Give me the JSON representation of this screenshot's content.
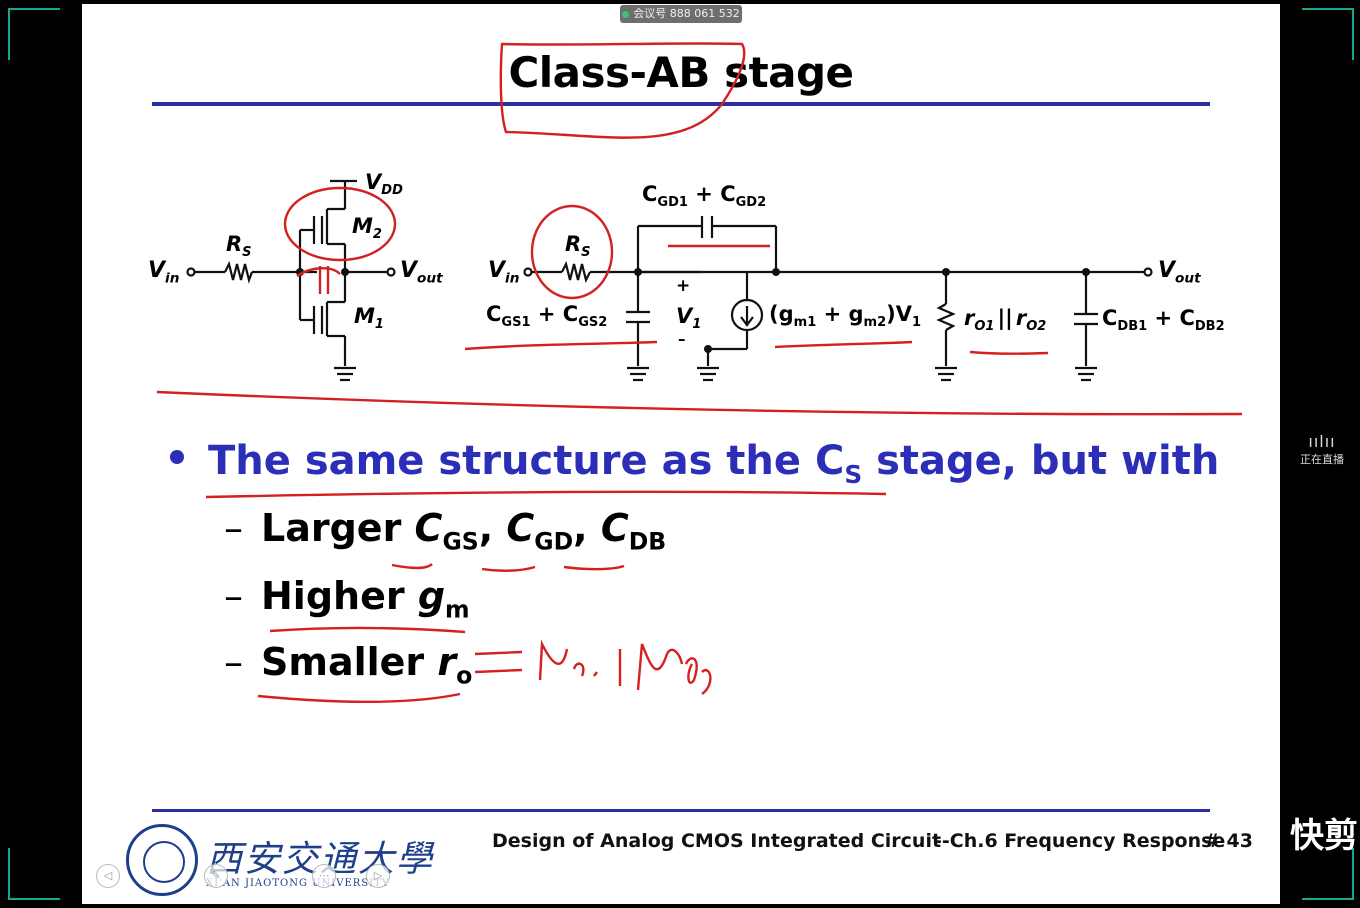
{
  "meeting_badge": "会议号 888 061 532",
  "slide": {
    "title": "Class-AB stage",
    "bullet": "The same structure as the C",
    "bullet_sub": "S",
    "bullet_tail": " stage, but with",
    "items": [
      {
        "text": "Larger ",
        "parts": [
          "C",
          "GS",
          ", ",
          "C",
          "GD",
          ", ",
          "C",
          "DB"
        ]
      },
      {
        "text": "Higher ",
        "parts": [
          "g",
          "m"
        ]
      },
      {
        "text": "Smaller ",
        "parts": [
          "r",
          "o"
        ]
      }
    ],
    "dash": "–",
    "footer_left": "Design of Analog CMOS Integrated Circuit",
    "footer_right": "--Ch.6 Frequency Response",
    "page": "# 43",
    "handwriting": "= r₀₁ || r₀₂",
    "university_cn": "西安交通大學",
    "university_en": "XI'AN JIAOTONG UNIVERSITY"
  },
  "circuit": {
    "vdd": "V",
    "vdd_sub": "DD",
    "m2": "M",
    "m2_sub": "2",
    "m1": "M",
    "m1_sub": "1",
    "rs": "R",
    "rs_sub": "S",
    "vin": "V",
    "vin_sub": "in",
    "vout": "V",
    "vout_sub": "out",
    "cgd": "C",
    "cgd1_sub": "GD1",
    "plus": "+",
    "cgd2_sub": "GD2",
    "cgs": "C",
    "cgs1_sub": "GS1",
    "cgs2_sub": "GS2",
    "v1": "V",
    "v1_sub": "1",
    "gm_text": "(g",
    "gm1_sub": "m1",
    "gm2": " + g",
    "gm2_sub": "m2",
    "gm_tail": ")V",
    "gm_tail_sub": "1",
    "ro": "r",
    "ro1_sub": "O1",
    "ro_sep": "||",
    "ro2_sub": "O2",
    "cdb": "C",
    "cdb1_sub": "DB1",
    "cdb2_sub": "DB2",
    "pos": "+",
    "neg": "–"
  },
  "side_panel": {
    "live_label": "正在直播",
    "app_logo": "快剪"
  },
  "colors": {
    "accent_blue": "#2b2fb8",
    "rule_blue": "#2b2f9c",
    "annotation_red": "#d42020",
    "frame_teal": "#15a88f"
  }
}
